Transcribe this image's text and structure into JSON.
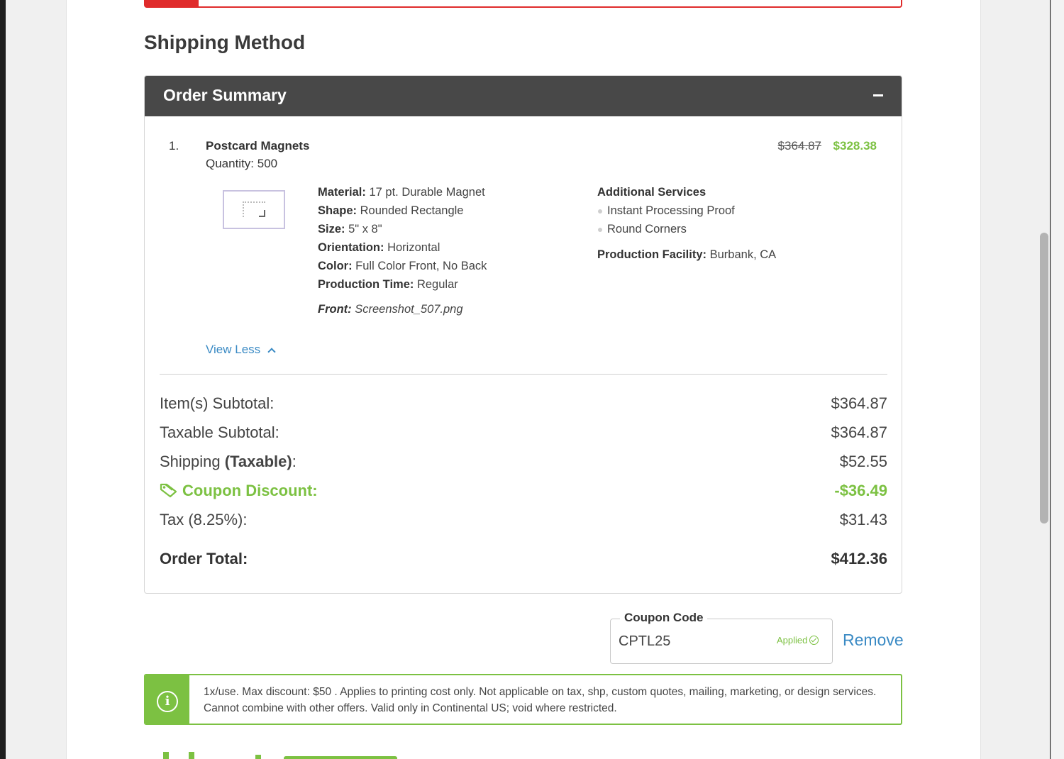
{
  "section_title": "Shipping Method",
  "order_summary": {
    "title": "Order Summary",
    "collapse_icon": "minus-icon",
    "item": {
      "number": "1.",
      "name": "Postcard Magnets",
      "quantity": "Quantity: 500",
      "price_original": "$364.87",
      "price_discounted": "$328.38",
      "specs": [
        {
          "label": "Material:",
          "value": "17 pt. Durable Magnet"
        },
        {
          "label": "Shape:",
          "value": "Rounded Rectangle"
        },
        {
          "label": "Size:",
          "value": "5\" x 8\""
        },
        {
          "label": "Orientation:",
          "value": "Horizontal"
        },
        {
          "label": "Color:",
          "value": "Full Color Front, No Back"
        },
        {
          "label": "Production Time:",
          "value": "Regular"
        }
      ],
      "front_label": "Front:",
      "front_file": "Screenshot_507.png",
      "additional_services_title": "Additional Services",
      "additional_services": [
        "Instant Processing Proof",
        "Round Corners"
      ],
      "facility_label": "Production Facility:",
      "facility_value": "Burbank, CA",
      "view_less": "View Less"
    },
    "totals": {
      "items_subtotal_label": "Item(s) Subtotal:",
      "items_subtotal": "$364.87",
      "taxable_subtotal_label": "Taxable Subtotal:",
      "taxable_subtotal": "$364.87",
      "shipping_label": "Shipping",
      "shipping_label_bold": "(Taxable)",
      "shipping_label_suffix": ":",
      "shipping": "$52.55",
      "coupon_label": "Coupon Discount:",
      "coupon": "-$36.49",
      "tax_label": "Tax (8.25%):",
      "tax": "$31.43",
      "order_total_label": "Order Total:",
      "order_total": "$412.36"
    }
  },
  "coupon": {
    "legend": "Coupon Code",
    "value": "CPTL25",
    "status": "Applied",
    "remove": "Remove"
  },
  "info": {
    "icon": "info-icon",
    "text": "1x/use. Max discount: $50 . Applies to printing cost only. Not applicable on tax, shp, custom quotes, mailing, marketing, or design services. Cannot combine with other offers. Valid only in Continental US; void where restricted."
  },
  "colors": {
    "accent_green": "#7cc142",
    "link_blue": "#3a8ac4",
    "header_dark": "#484848",
    "alert_red": "#e02b2b"
  }
}
